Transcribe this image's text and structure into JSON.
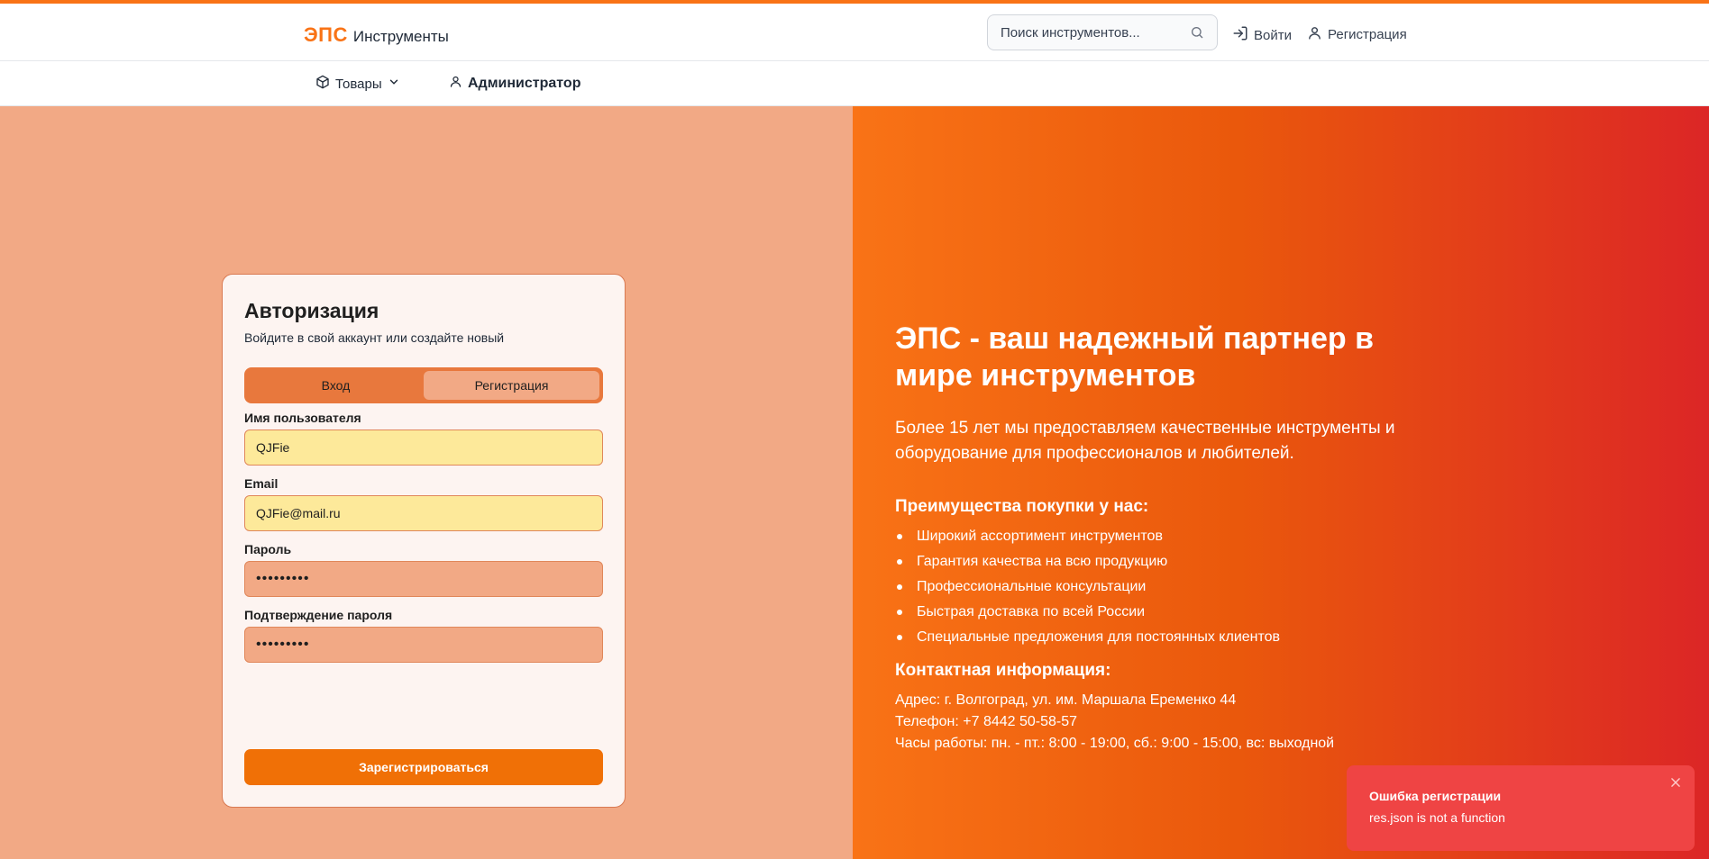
{
  "header": {
    "logo_mark": "ЭПС",
    "logo_text": "Инструменты",
    "search_placeholder": "Поиск инструментов...",
    "login": "Войти",
    "register": "Регистрация"
  },
  "nav": {
    "products": "Товары",
    "admin": "Администратор"
  },
  "auth_card": {
    "title": "Авторизация",
    "subtitle": "Войдите в свой аккаунт или создайте новый",
    "tabs": {
      "login": "Вход",
      "register": "Регистрация",
      "active": "register"
    },
    "fields": {
      "username_label": "Имя пользователя",
      "username_value": "QJFie",
      "email_label": "Email",
      "email_value": "QJFie@mail.ru",
      "password_label": "Пароль",
      "password_value": "123456789",
      "confirm_label": "Подтверждение пароля",
      "confirm_value": "123456789"
    },
    "submit": "Зарегистрироваться"
  },
  "promo": {
    "title": "ЭПС - ваш надежный партнер в мире инструментов",
    "text": "Более 15 лет мы предоставляем качественные инструменты и оборудование для профессионалов и любителей.",
    "advantages_title": "Преимущества покупки у нас:",
    "advantages": [
      "Широкий ассортимент инструментов",
      "Гарантия качества на всю продукцию",
      "Профессиональные консультации",
      "Быстрая доставка по всей России",
      "Специальные предложения для постоянных клиентов"
    ],
    "contact_title": "Контактная информация:",
    "address": "Адрес: г. Волгоград, ул. им. Маршала Еременко 44",
    "phone": "Телефон: +7 8442 50-58-57",
    "hours": "Часы работы: пн. - пт.: 8:00 - 19:00, сб.: 9:00 - 15:00, вс: выходной"
  },
  "toast": {
    "title": "Ошибка регистрации",
    "message": "res.json is not a function"
  },
  "colors": {
    "brand": "#f97316",
    "left_panel": "#f2a985",
    "toast": "#ef4444",
    "submit": "#f07006"
  }
}
